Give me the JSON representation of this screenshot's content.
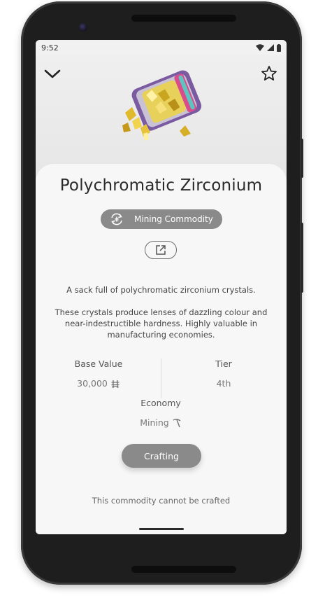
{
  "status_bar": {
    "time": "9:52"
  },
  "header": {
    "back_icon": "chevron-down-icon",
    "favorite_icon": "star-outline-icon"
  },
  "item": {
    "name": "Polychromatic Zirconium",
    "category": "Mining Commodity",
    "description_1": "A sack full of polychromatic zirconium crystals.",
    "description_2": "These crystals produce lenses of dazzling colour and near-indestructible hardness. Highly valuable in manufacturing economies."
  },
  "stats": {
    "base_value_label": "Base Value",
    "base_value": "30,000",
    "tier_label": "Tier",
    "tier": "4th",
    "economy_label": "Economy",
    "economy": "Mining"
  },
  "crafting": {
    "button_label": "Crafting",
    "note": "This commodity cannot be crafted"
  },
  "colors": {
    "accent_gray": "#8a8a8a",
    "card_bg": "#f7f7f7",
    "hero_bg": "#efefef"
  }
}
